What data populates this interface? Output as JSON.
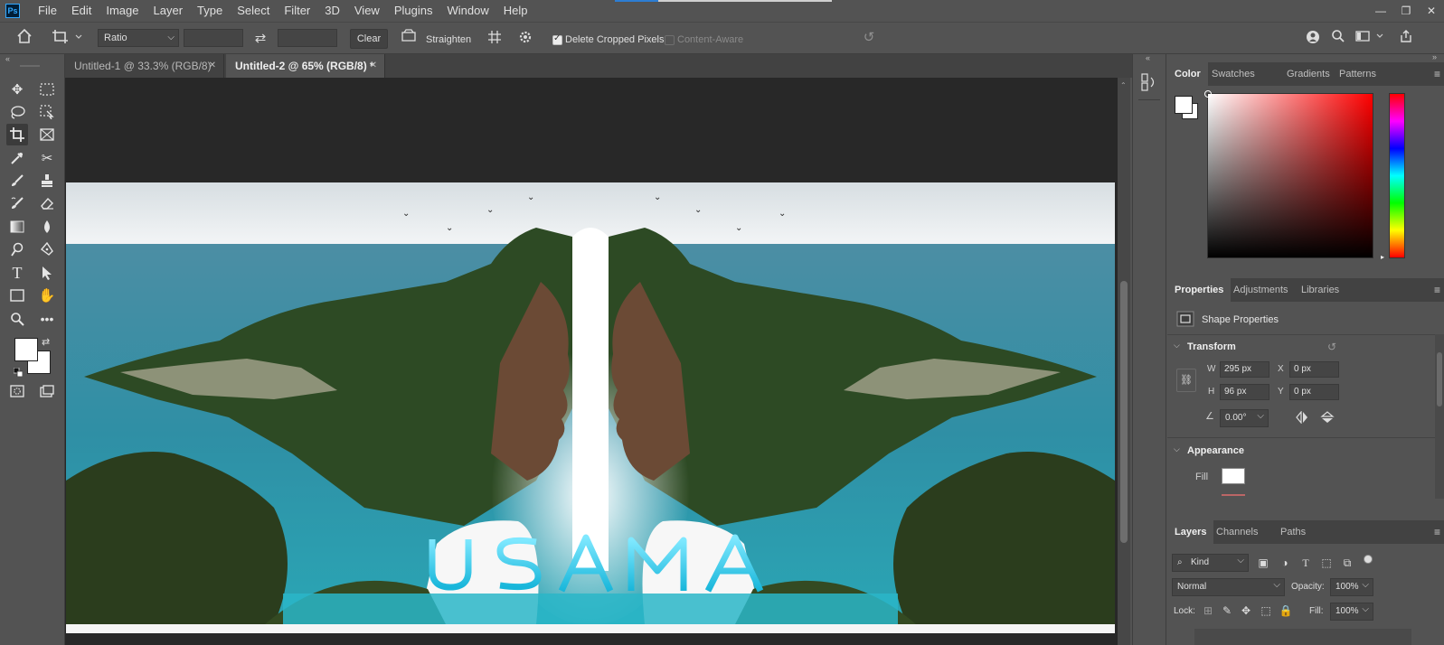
{
  "menubar": {
    "app_icon": "Ps",
    "items": [
      "File",
      "Edit",
      "Image",
      "Layer",
      "Type",
      "Select",
      "Filter",
      "3D",
      "View",
      "Plugins",
      "Window",
      "Help"
    ]
  },
  "window_controls": {
    "minimize": "—",
    "restore": "❐",
    "close": "✕"
  },
  "options": {
    "ratio_value": "Ratio",
    "width_value": "",
    "height_value": "",
    "swap_icon": "⇄",
    "clear_label": "Clear",
    "straighten_label": "Straighten",
    "delete_cropped_label": "Delete Cropped Pixels",
    "content_aware_label": "Content-Aware"
  },
  "doc_tabs": [
    {
      "label": "Untitled-1 @ 33.3% (RGB/8)",
      "active": false
    },
    {
      "label": "Untitled-2 @ 65% (RGB/8) *",
      "active": true
    }
  ],
  "artwork": {
    "text": "USAMA"
  },
  "color_panel": {
    "tabs": [
      "Color",
      "Swatches",
      "Gradients",
      "Patterns"
    ],
    "active_tab": "Color",
    "hue_color": "#ff0000"
  },
  "properties_panel": {
    "tabs": [
      "Properties",
      "Adjustments",
      "Libraries"
    ],
    "shape_label": "Shape Properties",
    "transform_label": "Transform",
    "w_label": "W",
    "w_value": "295 px",
    "h_label": "H",
    "h_value": "96 px",
    "x_label": "X",
    "x_value": "0 px",
    "y_label": "Y",
    "y_value": "0 px",
    "angle_value": "0.00°",
    "appearance_label": "Appearance",
    "fill_label": "Fill"
  },
  "layers_panel": {
    "tabs": [
      "Layers",
      "Channels",
      "Paths"
    ],
    "kind_label": "Kind",
    "blend_mode": "Normal",
    "opacity_label": "Opacity:",
    "opacity_value": "100%",
    "lock_label": "Lock:",
    "fill_label": "Fill:",
    "fill_value": "100%"
  }
}
